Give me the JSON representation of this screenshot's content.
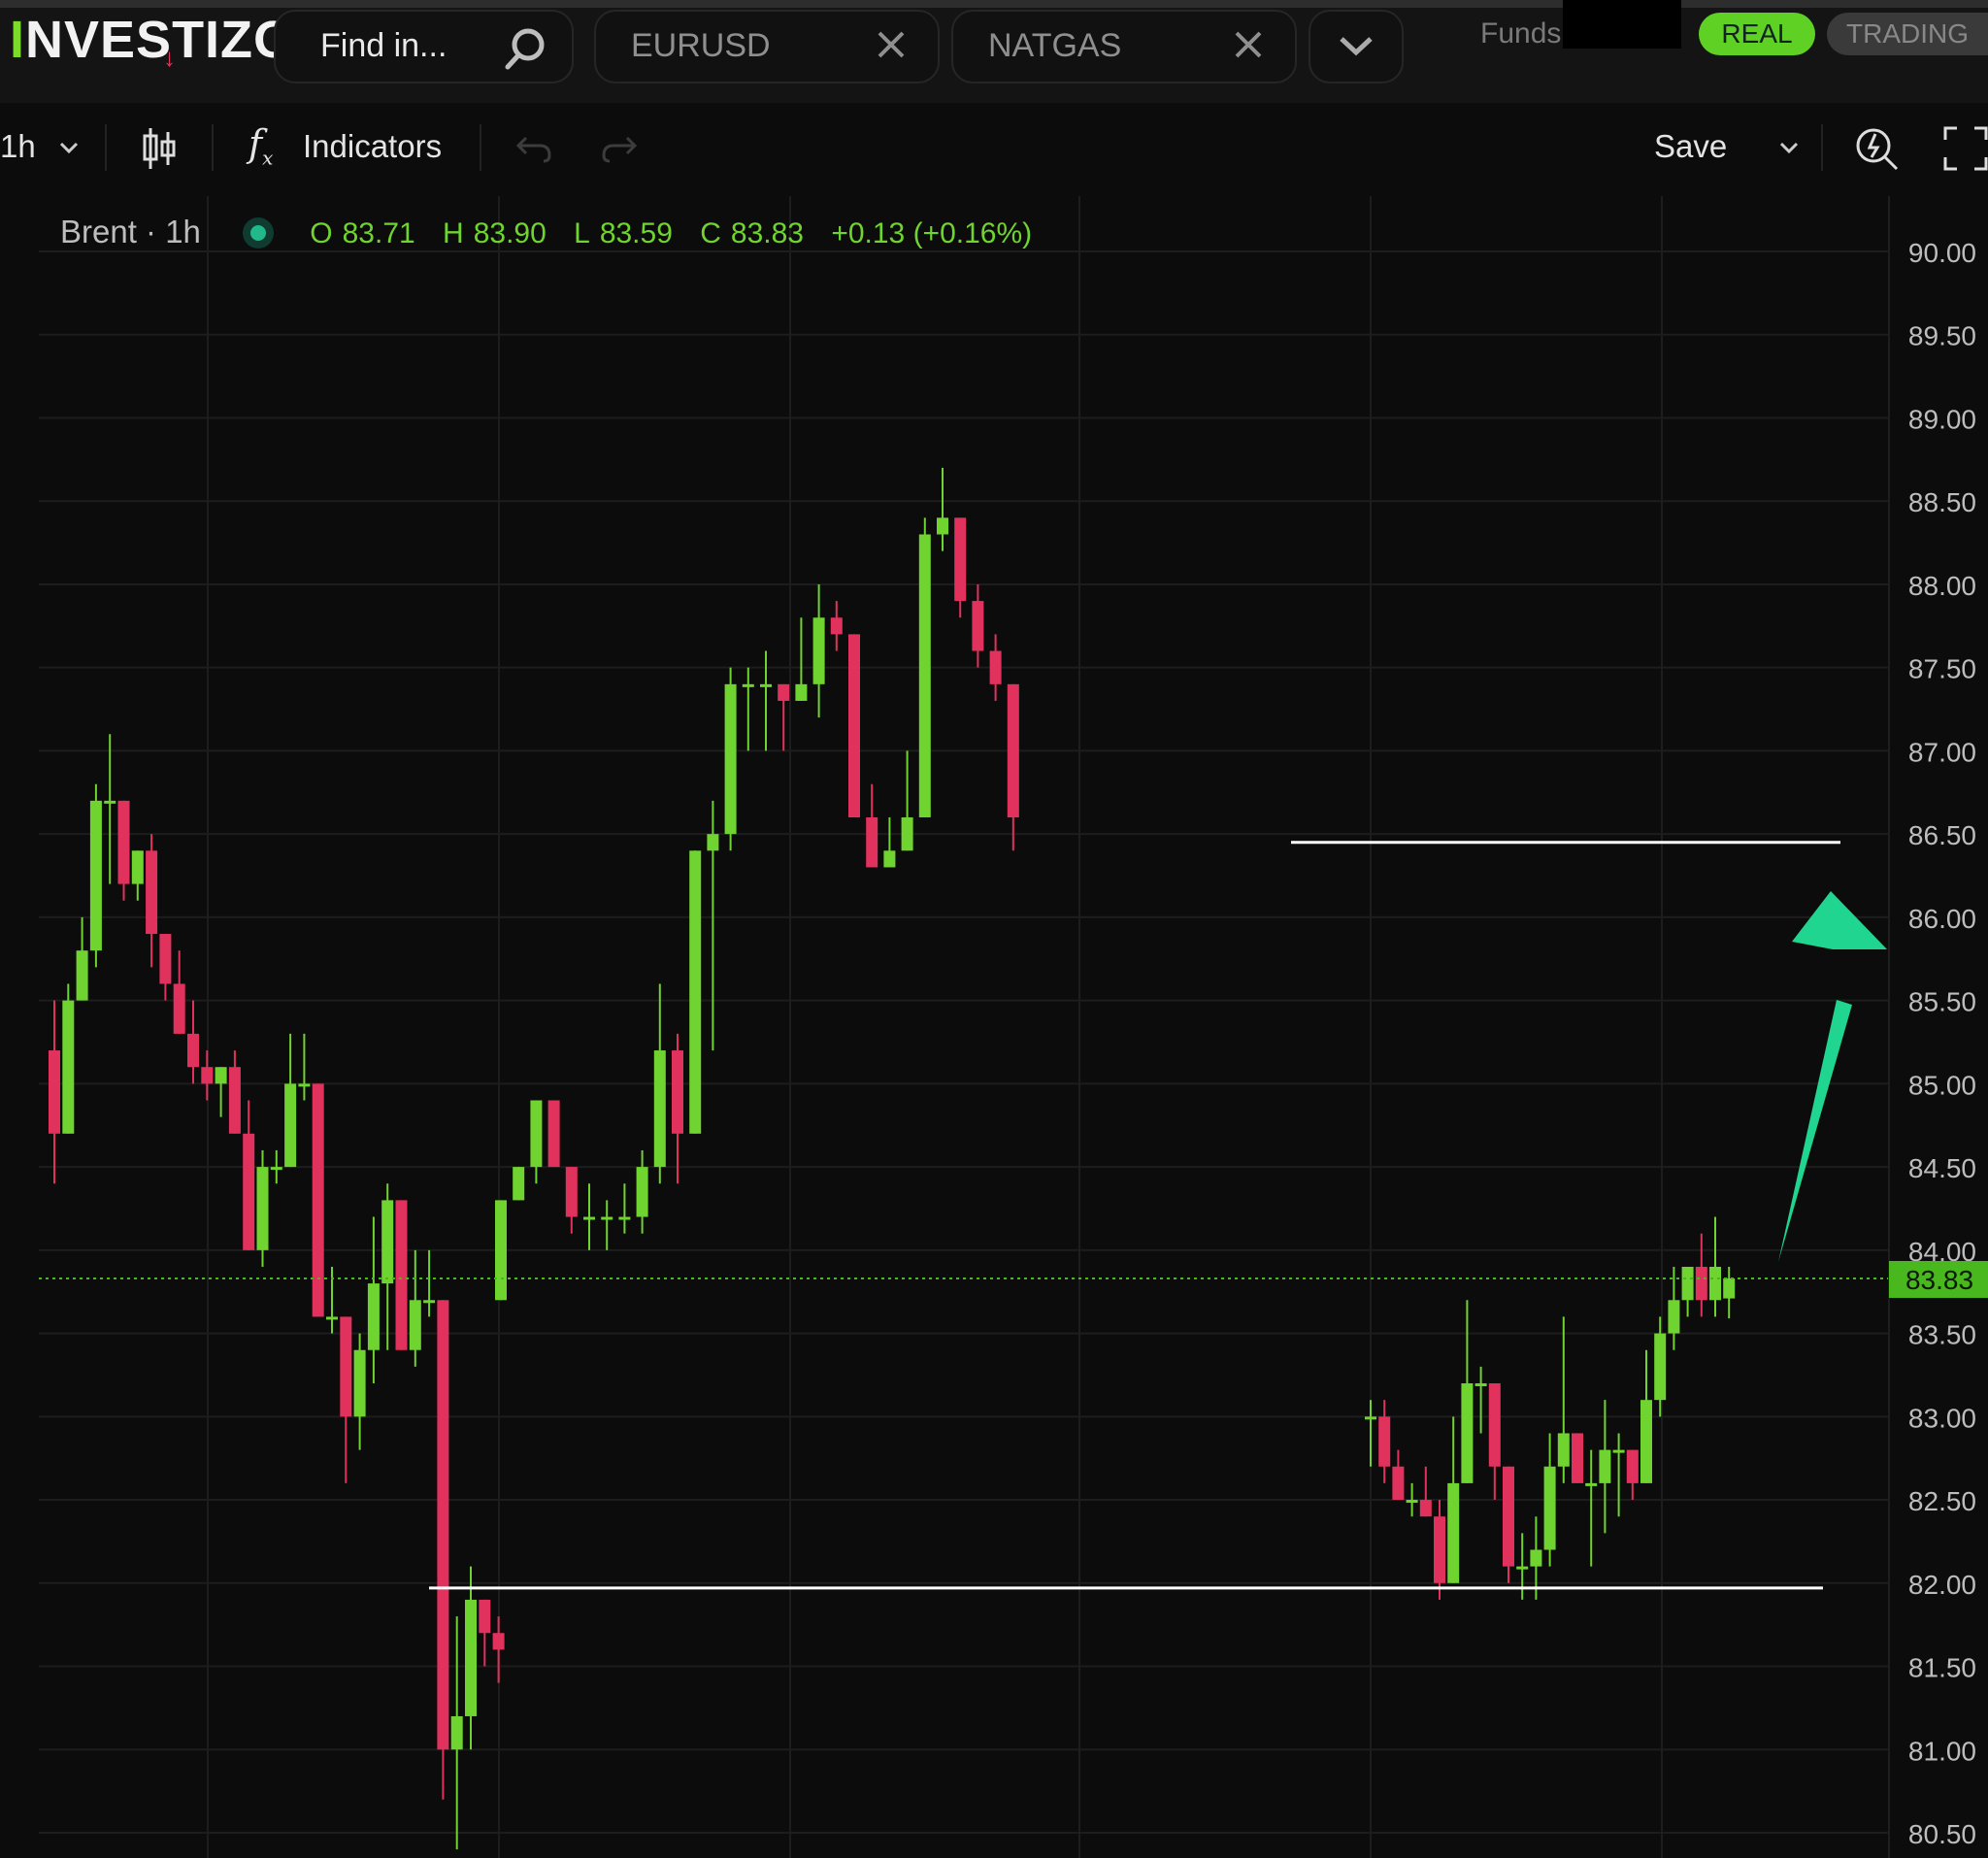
{
  "app": {
    "logo": "INVESTIZO",
    "search_placeholder": "Find in...",
    "tabs": [
      {
        "label": "EURUSD"
      },
      {
        "label": "NATGAS"
      }
    ],
    "funds_label": "Funds:",
    "account_modes": {
      "real": "REAL",
      "trading": "TRADING"
    }
  },
  "toolbar": {
    "interval": "1h",
    "indicators_label": "Indicators",
    "save_label": "Save"
  },
  "legend": {
    "symbol": "Brent · 1h",
    "open_label": "O",
    "open": "83.71",
    "high_label": "H",
    "high": "83.90",
    "low_label": "L",
    "low": "83.59",
    "close_label": "C",
    "close": "83.83",
    "change": "+0.13 (+0.16%)"
  },
  "colors": {
    "up": "#6fd330",
    "down": "#e1325e",
    "price_tag": "#49b81f",
    "arrow": "#1fd58f",
    "level_line": "#ffffff",
    "background": "#0c0c0c"
  },
  "chart_data": {
    "type": "candlestick",
    "symbol": "Brent",
    "timeframe": "1h",
    "ylim": [
      80.5,
      90.0
    ],
    "y_ticks": [
      "90.00",
      "89.50",
      "89.00",
      "88.50",
      "88.00",
      "87.50",
      "87.00",
      "86.50",
      "86.00",
      "85.50",
      "85.00",
      "84.50",
      "84.00",
      "83.50",
      "83.00",
      "82.50",
      "82.00",
      "81.50",
      "81.00",
      "80.50"
    ],
    "last_price": "83.83",
    "candles": [
      [
        85.2,
        85.5,
        84.4,
        84.7
      ],
      [
        84.7,
        85.6,
        84.7,
        85.5
      ],
      [
        85.5,
        86.0,
        85.5,
        85.8
      ],
      [
        85.8,
        86.8,
        85.7,
        86.7
      ],
      [
        86.7,
        87.1,
        86.2,
        86.7
      ],
      [
        86.7,
        86.7,
        86.1,
        86.2
      ],
      [
        86.2,
        86.4,
        86.1,
        86.4
      ],
      [
        86.4,
        86.5,
        85.7,
        85.9
      ],
      [
        85.9,
        85.9,
        85.5,
        85.6
      ],
      [
        85.6,
        85.8,
        85.3,
        85.3
      ],
      [
        85.3,
        85.5,
        85.0,
        85.1
      ],
      [
        85.1,
        85.2,
        84.9,
        85.0
      ],
      [
        85.0,
        85.1,
        84.8,
        85.1
      ],
      [
        85.1,
        85.2,
        84.7,
        84.7
      ],
      [
        84.7,
        84.9,
        84.0,
        84.0
      ],
      [
        84.0,
        84.6,
        83.9,
        84.5
      ],
      [
        84.5,
        84.6,
        84.4,
        84.5
      ],
      [
        84.5,
        85.3,
        84.5,
        85.0
      ],
      [
        85.0,
        85.3,
        84.9,
        85.0
      ],
      [
        85.0,
        85.0,
        83.6,
        83.6
      ],
      [
        83.6,
        83.9,
        83.5,
        83.6
      ],
      [
        83.6,
        83.6,
        82.6,
        83.0
      ],
      [
        83.0,
        83.5,
        82.8,
        83.4
      ],
      [
        83.4,
        84.2,
        83.2,
        83.8
      ],
      [
        83.8,
        84.4,
        83.4,
        84.3
      ],
      [
        84.3,
        84.3,
        83.4,
        83.4
      ],
      [
        83.4,
        84.0,
        83.3,
        83.7
      ],
      [
        83.7,
        84.0,
        83.6,
        83.7
      ],
      [
        83.7,
        83.7,
        80.7,
        81.0
      ],
      [
        81.0,
        81.8,
        80.4,
        81.2
      ],
      [
        81.2,
        82.1,
        81.0,
        81.9
      ],
      [
        81.9,
        81.9,
        81.5,
        81.7
      ],
      [
        81.7,
        81.8,
        81.4,
        81.6
      ]
    ],
    "candles_gap": [
      [
        83.7,
        84.3,
        83.7,
        84.3
      ],
      [
        84.3,
        84.5,
        84.3,
        84.5
      ],
      [
        84.5,
        84.9,
        84.4,
        84.9
      ],
      [
        84.9,
        84.9,
        84.5,
        84.5
      ],
      [
        84.5,
        84.5,
        84.1,
        84.2
      ],
      [
        84.2,
        84.4,
        84.0,
        84.2
      ],
      [
        84.2,
        84.3,
        84.0,
        84.2
      ],
      [
        84.2,
        84.4,
        84.1,
        84.2
      ],
      [
        84.2,
        84.6,
        84.1,
        84.5
      ],
      [
        84.5,
        85.6,
        84.4,
        85.2
      ],
      [
        85.2,
        85.3,
        84.4,
        84.7
      ],
      [
        84.7,
        86.4,
        84.7,
        86.4
      ],
      [
        86.4,
        86.7,
        85.2,
        86.5
      ],
      [
        86.5,
        87.5,
        86.4,
        87.4
      ],
      [
        87.4,
        87.5,
        87.0,
        87.4
      ],
      [
        87.4,
        87.6,
        87.0,
        87.4
      ],
      [
        87.4,
        87.4,
        87.0,
        87.3
      ],
      [
        87.3,
        87.8,
        87.3,
        87.4
      ],
      [
        87.4,
        88.0,
        87.2,
        87.8
      ],
      [
        87.8,
        87.9,
        87.6,
        87.7
      ],
      [
        87.7,
        87.7,
        86.7,
        86.6
      ],
      [
        86.6,
        86.8,
        86.3,
        86.3
      ],
      [
        86.3,
        86.6,
        86.3,
        86.4
      ],
      [
        86.4,
        87.0,
        86.4,
        86.6
      ],
      [
        86.6,
        88.4,
        86.6,
        88.3
      ],
      [
        88.3,
        88.7,
        88.2,
        88.4
      ],
      [
        88.4,
        88.4,
        87.8,
        87.9
      ],
      [
        87.9,
        88.0,
        87.5,
        87.6
      ],
      [
        87.6,
        87.7,
        87.3,
        87.4
      ],
      [
        87.4,
        87.4,
        86.4,
        86.6
      ]
    ],
    "annotations": {
      "resistance_level": 86.45,
      "support_level": 81.97,
      "arrow_direction": "up"
    }
  }
}
